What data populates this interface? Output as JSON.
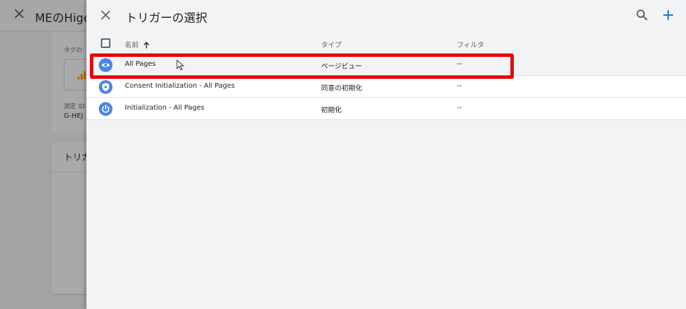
{
  "background": {
    "title": "MEのHige",
    "tag_label": "タグの",
    "measure_id_label": "測定 ID",
    "measure_id_value": "G-HEJ",
    "card_title": "トリガ"
  },
  "panel": {
    "title": "トリガーの選択",
    "columns": {
      "name": "名前",
      "type": "タイプ",
      "filter": "フィルタ"
    },
    "rows": [
      {
        "name": "All Pages",
        "type": "ページビュー",
        "filter": "--",
        "icon": "eye-icon"
      },
      {
        "name": "Consent Initialization - All Pages",
        "type": "同意の初期化",
        "filter": "--",
        "icon": "shield-icon"
      },
      {
        "name": "Initialization - All Pages",
        "type": "初期化",
        "filter": "--",
        "icon": "power-icon"
      }
    ]
  },
  "colors": {
    "accent": "#1a73e8",
    "trigger_icon": "#4a86e8",
    "highlight": "#e8000b"
  }
}
